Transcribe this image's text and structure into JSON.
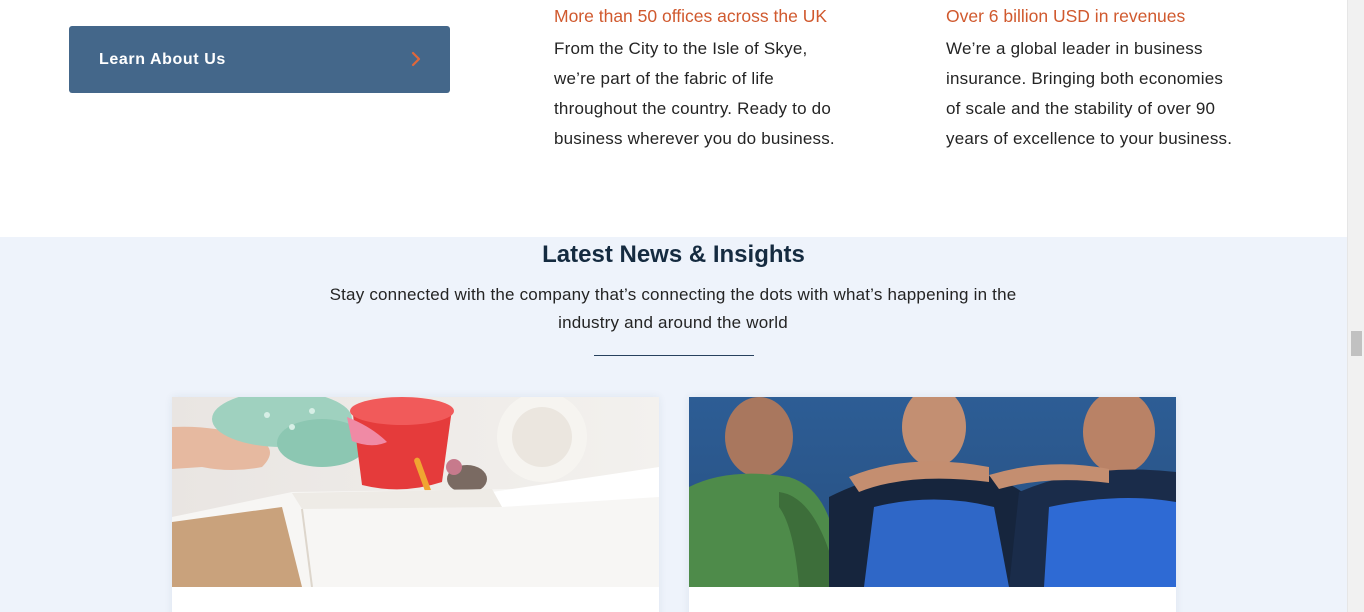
{
  "about": {
    "button_label": "Learn About Us"
  },
  "stats": [
    {
      "title": "More than 50 offices across the UK",
      "lines": [
        "From the City to the Isle of Skye,",
        "we’re part of the fabric of life",
        "throughout the country. Ready to do",
        "business wherever you do business."
      ]
    },
    {
      "title": "Over 6 billion USD in revenues",
      "lines": [
        "We’re a global leader in business",
        "insurance. Bringing both economies",
        "of scale and the stability of over 90",
        "years of excellence to your business."
      ]
    }
  ],
  "news": {
    "title": "Latest News & Insights",
    "subtitle_lines": [
      "Stay connected with the company that’s connecting the dots with what’s happening in the",
      "industry and around the world"
    ],
    "cards": [
      {
        "image": "donation-box-toys-photo"
      },
      {
        "image": "rugby-team-huddle-photo"
      }
    ]
  },
  "colors": {
    "accent_orange": "#d0592e",
    "button_blue": "#44678a",
    "heading_navy": "#152b40",
    "section_bg": "#eef3fb"
  },
  "icons": {
    "button_chevron": "chevron-right-icon"
  }
}
